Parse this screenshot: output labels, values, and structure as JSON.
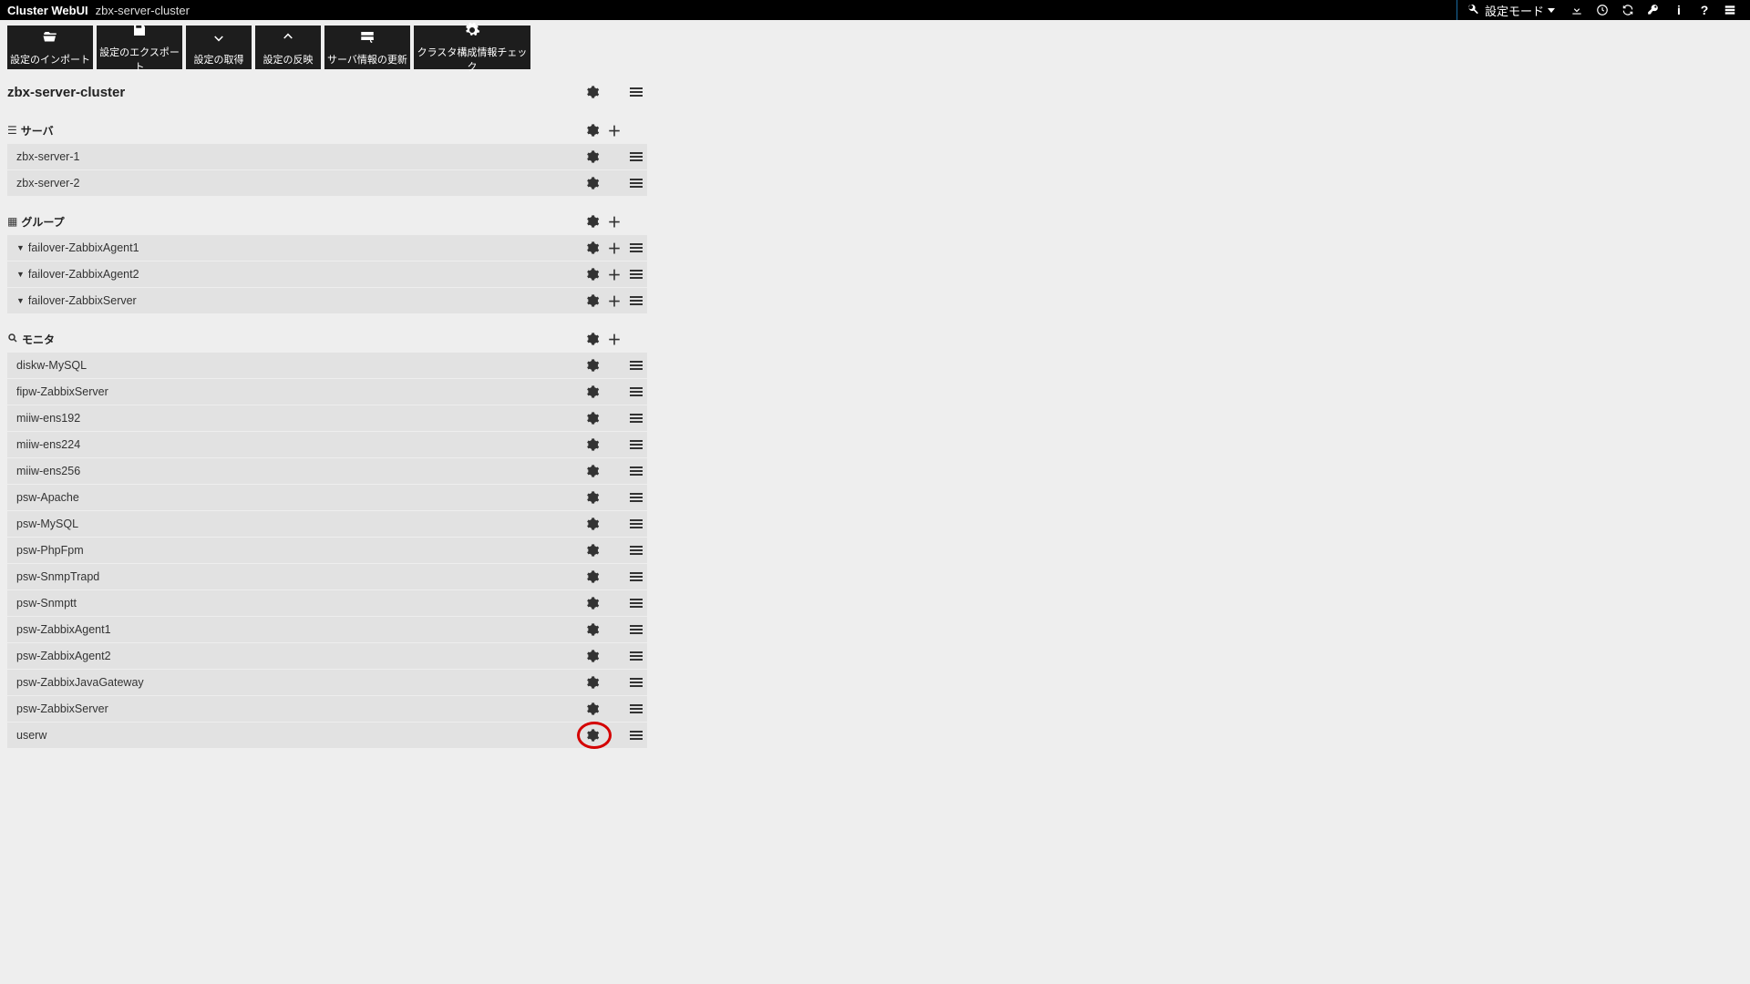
{
  "topbar": {
    "app_title": "Cluster WebUI",
    "cluster_name": "zbx-server-cluster",
    "mode_label": "設定モード",
    "icons": [
      "download-icon",
      "clock-icon",
      "refresh-icon",
      "key-icon",
      "info-icon",
      "help-icon",
      "panel-icon"
    ]
  },
  "toolbar": {
    "import": {
      "label": "設定のインポート"
    },
    "export": {
      "label": "設定のエクスポート"
    },
    "get": {
      "label": "設定の取得"
    },
    "apply": {
      "label": "設定の反映"
    },
    "refresh": {
      "label": "サーバ情報の更新"
    },
    "check": {
      "label": "クラスタ構成情報チェック"
    }
  },
  "cluster": {
    "name": "zbx-server-cluster"
  },
  "servers": {
    "header": "サーバ",
    "items": [
      {
        "name": "zbx-server-1"
      },
      {
        "name": "zbx-server-2"
      }
    ]
  },
  "groups": {
    "header": "グループ",
    "items": [
      {
        "name": "failover-ZabbixAgent1"
      },
      {
        "name": "failover-ZabbixAgent2"
      },
      {
        "name": "failover-ZabbixServer"
      }
    ]
  },
  "monitors": {
    "header": "モニタ",
    "items": [
      {
        "name": "diskw-MySQL"
      },
      {
        "name": "fipw-ZabbixServer"
      },
      {
        "name": "miiw-ens192"
      },
      {
        "name": "miiw-ens224"
      },
      {
        "name": "miiw-ens256"
      },
      {
        "name": "psw-Apache"
      },
      {
        "name": "psw-MySQL"
      },
      {
        "name": "psw-PhpFpm"
      },
      {
        "name": "psw-SnmpTrapd"
      },
      {
        "name": "psw-Snmptt"
      },
      {
        "name": "psw-ZabbixAgent1"
      },
      {
        "name": "psw-ZabbixAgent2"
      },
      {
        "name": "psw-ZabbixJavaGateway"
      },
      {
        "name": "psw-ZabbixServer"
      },
      {
        "name": "userw",
        "highlight_gear": true
      }
    ]
  }
}
